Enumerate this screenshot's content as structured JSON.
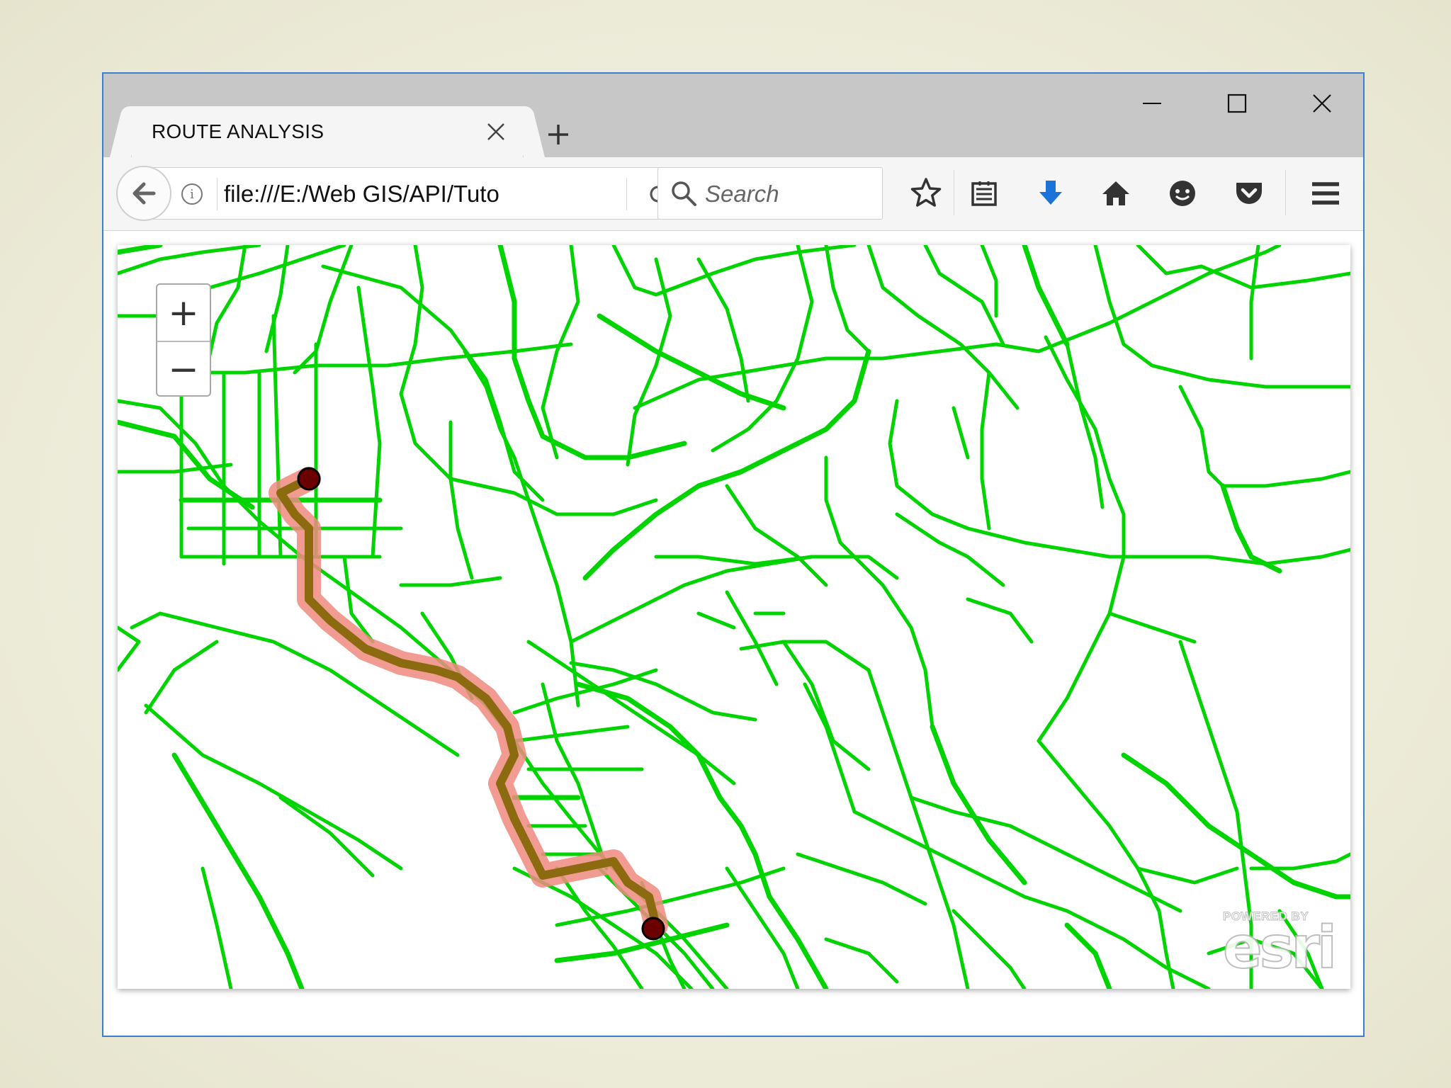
{
  "window": {
    "tab_title": "ROUTE ANALYSIS",
    "url": "file:///E:/Web GIS/API/Tuto",
    "search_placeholder": "Search"
  },
  "toolbar_icons": [
    "back-icon",
    "info-icon",
    "reload-icon",
    "search-icon",
    "bookmark-star-icon",
    "reading-list-icon",
    "download-icon",
    "home-icon",
    "hello-chat-icon",
    "pocket-icon",
    "menu-icon"
  ],
  "map": {
    "zoom_in": "+",
    "zoom_out": "−",
    "attribution_small": "POWERED BY",
    "attribution_logo": "esri",
    "colors": {
      "roads": "#00d400",
      "route_buffer": "#f08a80",
      "route_line": "#8b6a10",
      "stops": "#6b0000"
    }
  }
}
